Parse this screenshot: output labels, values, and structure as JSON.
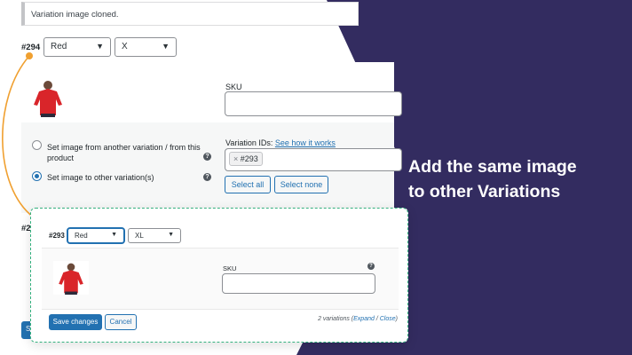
{
  "notice": {
    "text": "Variation image cloned."
  },
  "back_variation": {
    "number": "#294",
    "attribute_1": "Red",
    "attribute_2": "X",
    "sku_label": "SKU",
    "option_1": "Set image from another variation / from this product",
    "option_2": "Set image to other variation(s)",
    "ids_label": "Variation IDs:",
    "ids_link": "See how it works",
    "chip_remove": "×",
    "chip_value": "#293",
    "select_all": "Select all",
    "select_none": "Select none",
    "next_number_partial": "#2",
    "hidden_button_partial": "S"
  },
  "front_variation": {
    "number": "#293",
    "attribute_1": "Red",
    "attribute_2": "XL",
    "sku_label": "SKU"
  },
  "footer": {
    "save": "Save changes",
    "cancel": "Cancel",
    "count": "2 variations",
    "expand": "Expand",
    "separator": "/",
    "close": "Close"
  },
  "headline": {
    "line1": "Add the same image",
    "line2": "to other Variations"
  },
  "icons": {
    "help": "help-icon",
    "chevron": "chevron-down-icon",
    "tshirt": "product-thumbnail"
  },
  "colors": {
    "panel": "#332c60",
    "accent": "#2271b1",
    "connector": "#f0a030",
    "card_border": "#35b17f"
  }
}
